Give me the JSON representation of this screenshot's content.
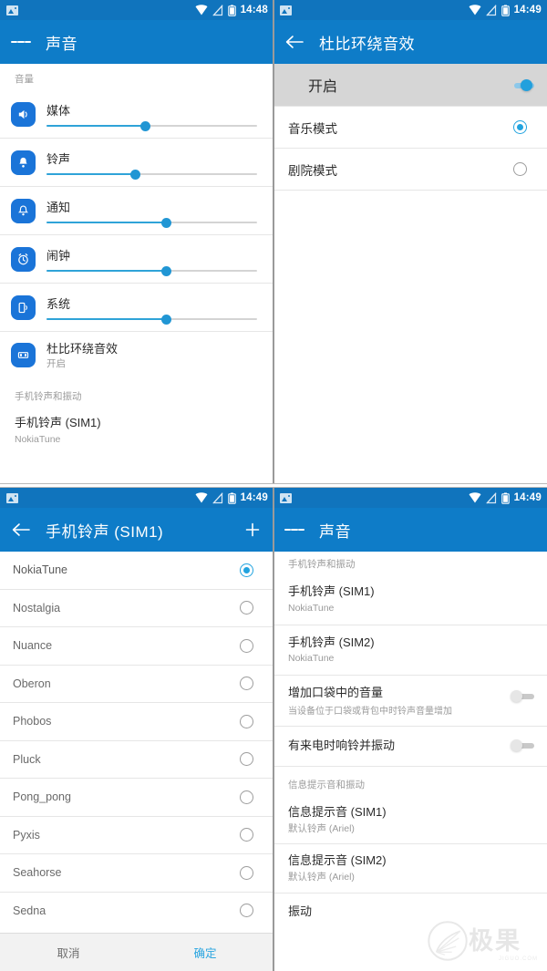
{
  "colors": {
    "status_bar": "#1074bd",
    "app_bar": "#0e7cc8",
    "accent": "#21a3df",
    "slider_fill": "#2fa3d8",
    "icon_blue": "#1a74d8",
    "selected_row_bg": "#d6d6d6"
  },
  "panels": {
    "sound_main": {
      "status": {
        "time": "14:48",
        "icons": [
          "photo-icon",
          "wifi-icon",
          "signal-off-icon",
          "battery-icon"
        ]
      },
      "appbar": {
        "nav_icon": "hamburger-icon",
        "title": "声音"
      },
      "section_volume": "音量",
      "volumes": [
        {
          "icon": "speaker-icon",
          "label": "媒体",
          "percent": 47
        },
        {
          "icon": "bell-icon",
          "label": "铃声",
          "percent": 42
        },
        {
          "icon": "notification-icon",
          "label": "通知",
          "percent": 57
        },
        {
          "icon": "alarm-icon",
          "label": "闹钟",
          "percent": 57
        },
        {
          "icon": "phone-sound-icon",
          "label": "系统",
          "percent": 57
        }
      ],
      "dolby": {
        "icon": "dolby-icon",
        "title": "杜比环绕音效",
        "subtitle": "开启"
      },
      "section_ringtone": "手机铃声和振动",
      "ringtone_sim1": {
        "title": "手机铃声 (SIM1)",
        "subtitle": "NokiaTune"
      }
    },
    "dolby": {
      "status": {
        "time": "14:49"
      },
      "appbar": {
        "nav_icon": "back-arrow-icon",
        "title": "杜比环绕音效"
      },
      "master": {
        "label": "开启",
        "enabled": true
      },
      "modes": [
        {
          "label": "音乐模式",
          "selected": true
        },
        {
          "label": "剧院模式",
          "selected": false
        }
      ]
    },
    "ringtone_picker": {
      "status": {
        "time": "14:49"
      },
      "appbar": {
        "nav_icon": "back-arrow-icon",
        "title": "手机铃声 (SIM1)",
        "action_icon": "plus-icon"
      },
      "tones": [
        {
          "label": "NokiaTune",
          "selected": true
        },
        {
          "label": "Nostalgia",
          "selected": false
        },
        {
          "label": "Nuance",
          "selected": false
        },
        {
          "label": "Oberon",
          "selected": false
        },
        {
          "label": "Phobos",
          "selected": false
        },
        {
          "label": "Pluck",
          "selected": false
        },
        {
          "label": "Pong_pong",
          "selected": false
        },
        {
          "label": "Pyxis",
          "selected": false
        },
        {
          "label": "Seahorse",
          "selected": false
        },
        {
          "label": "Sedna",
          "selected": false
        }
      ],
      "buttons": {
        "cancel": "取消",
        "ok": "确定"
      }
    },
    "sound_scrolled": {
      "status": {
        "time": "14:49"
      },
      "appbar": {
        "nav_icon": "hamburger-icon",
        "title": "声音"
      },
      "section_ringtone": "手机铃声和振动",
      "items": [
        {
          "title": "手机铃声 (SIM1)",
          "subtitle": "NokiaTune"
        },
        {
          "title": "手机铃声 (SIM2)",
          "subtitle": "NokiaTune"
        }
      ],
      "toggles": [
        {
          "title": "增加口袋中的音量",
          "subtitle": "当设备位于口袋或背包中时铃声音量增加",
          "enabled": false
        },
        {
          "title": "有来电时响铃并振动",
          "subtitle": "",
          "enabled": false
        }
      ],
      "section_message": "信息提示音和振动",
      "message_items": [
        {
          "title": "信息提示音 (SIM1)",
          "subtitle": "默认铃声 (Ariel)"
        },
        {
          "title": "信息提示音 (SIM2)",
          "subtitle": "默认铃声 (Ariel)"
        }
      ],
      "vibrate": {
        "title": "振动"
      }
    }
  },
  "watermark": {
    "text": "极果",
    "sub": "JIGUO.COM"
  }
}
